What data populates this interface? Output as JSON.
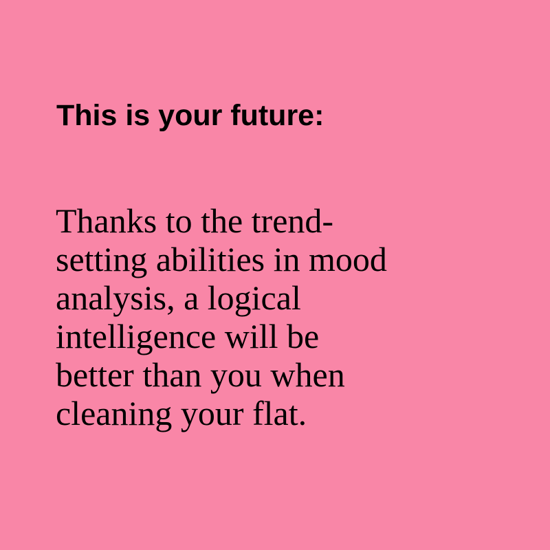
{
  "colors": {
    "background": "#f986a7",
    "text": "#000000"
  },
  "card": {
    "heading": "This is your future:",
    "body_lines": [
      "Thanks to the trend-",
      "setting abilities in mood",
      "analysis, a logical",
      "intelligence will be",
      "better than you when",
      "cleaning your flat."
    ]
  }
}
